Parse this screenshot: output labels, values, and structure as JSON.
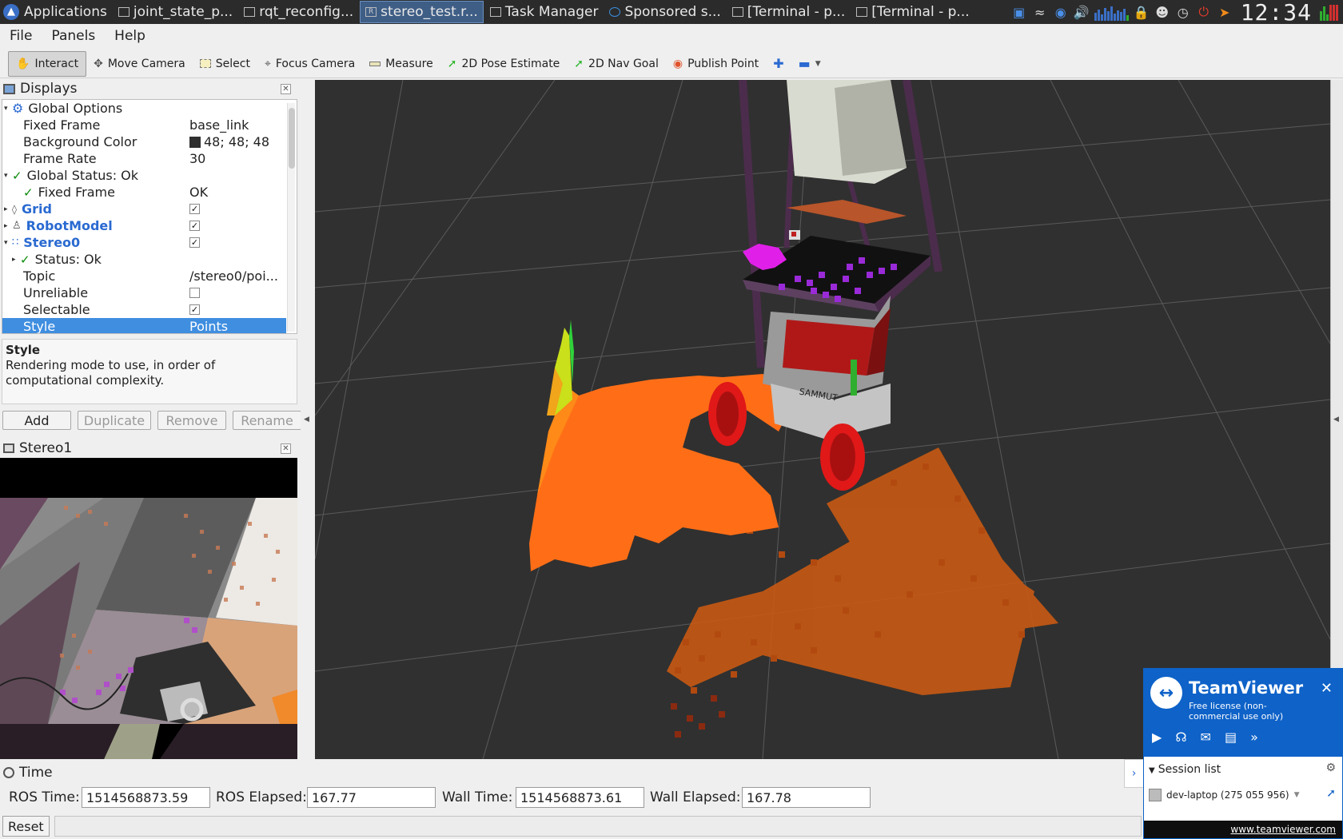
{
  "taskbar": {
    "apps_label": "Applications",
    "tasks": [
      {
        "label": "joint_state_p..."
      },
      {
        "label": "rqt_reconfig..."
      },
      {
        "label": "stereo_test.r..."
      },
      {
        "label": "Task Manager"
      },
      {
        "label": "Sponsored s..."
      },
      {
        "label": "[Terminal - p..."
      },
      {
        "label": "[Terminal - p..."
      }
    ],
    "clock": "12:34"
  },
  "menubar": {
    "file": "File",
    "panels": "Panels",
    "help": "Help"
  },
  "toolbar": {
    "interact": "Interact",
    "move_camera": "Move Camera",
    "select": "Select",
    "focus_camera": "Focus Camera",
    "measure": "Measure",
    "pose_estimate": "2D Pose Estimate",
    "nav_goal": "2D Nav Goal",
    "publish_point": "Publish Point"
  },
  "displays": {
    "title": "Displays",
    "rows": {
      "global_options": "Global Options",
      "fixed_frame_label": "Fixed Frame",
      "fixed_frame_value": "base_link",
      "bg_color_label": "Background Color",
      "bg_color_value": "48; 48; 48",
      "frame_rate_label": "Frame Rate",
      "frame_rate_value": "30",
      "global_status": "Global Status: Ok",
      "gs_fixed_frame": "Fixed Frame",
      "gs_fixed_frame_value": "OK",
      "grid": "Grid",
      "robot_model": "RobotModel",
      "stereo0": "Stereo0",
      "status_ok": "Status: Ok",
      "topic_label": "Topic",
      "topic_value": "/stereo0/poi...",
      "unreliable_label": "Unreliable",
      "selectable_label": "Selectable",
      "style_label": "Style",
      "style_value": "Points"
    },
    "checks": {
      "grid": true,
      "robot_model": true,
      "stereo0": true,
      "unreliable": false,
      "selectable": true
    },
    "bg_color_hex": "#303030"
  },
  "description": {
    "title": "Style",
    "text": "Rendering mode to use, in order of computational complexity."
  },
  "buttons": {
    "add": "Add",
    "duplicate": "Duplicate",
    "remove": "Remove",
    "rename": "Rename"
  },
  "stereo1": {
    "title": "Stereo1"
  },
  "time": {
    "title": "Time",
    "ros_time_label": "ROS Time:",
    "ros_time": "1514568873.59",
    "ros_elapsed_label": "ROS Elapsed:",
    "ros_elapsed": "167.77",
    "wall_time_label": "Wall Time:",
    "wall_time": "1514568873.61",
    "wall_elapsed_label": "Wall Elapsed:",
    "wall_elapsed": "167.78",
    "reset": "Reset"
  },
  "teamviewer": {
    "name": "TeamViewer",
    "subtitle": "Free license (non-commercial use only)",
    "session_list": "Session list",
    "device": "dev-laptop (275 055 956)",
    "footer": "www.teamviewer.com"
  },
  "robot": {
    "label": "SAMMUT"
  },
  "colors": {
    "accent": "#3f8ee0",
    "bold_item": "#2a6ad1",
    "tv_blue": "#0e62c8"
  }
}
